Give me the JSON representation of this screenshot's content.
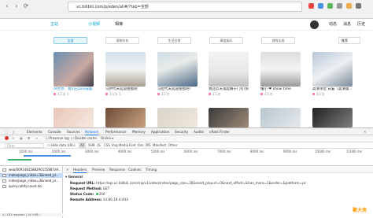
{
  "browser": {
    "url": "vc.bilibili.com/p/eden/all#/?tab=全部",
    "tabs": "",
    "nav": [
      "‹",
      "›",
      "⟳"
    ]
  },
  "site_header": {
    "home": "主站",
    "mini_video": "小视频",
    "album": "相簿",
    "right_items": [
      "动态",
      "消息",
      "历史"
    ]
  },
  "categories": [
    "全部",
    "宠物文化",
    "生活日常",
    "搞笑娱乐",
    "游戏达成"
  ],
  "sort_label": "推荐",
  "cards_row1": [
    {
      "title": "AI世界、我们已Dev成都...",
      "meta": "4万次 3"
    },
    {
      "title": "乌伊代天延迎接图吧",
      "meta": "2万次 3"
    },
    {
      "title": "乌拉代天延迎接图吧！",
      "meta": "4万次"
    },
    {
      "title": "我还云天景起舞于门打(好看",
      "meta": "2万次"
    },
    {
      "title": "懂小 ❤ show time",
      "meta": "4万次"
    },
    {
      "title": "高清单位 白猫（高清版...",
      "meta": "4万次"
    }
  ],
  "devtools": {
    "tabs": [
      "Elements",
      "Console",
      "Sources",
      "Network",
      "Performance",
      "Memory",
      "Application",
      "Security",
      "Audits",
      "vRats Finder"
    ],
    "active_tab": "Network",
    "toolbar": [
      "Preserve log",
      "Disable cache",
      "Online"
    ],
    "filters": [
      "Filter",
      "Hide data URLs",
      "All",
      "XHR",
      "JS",
      "CSS",
      "Img",
      "Media",
      "Font",
      "Doc",
      "WS",
      "Manifest",
      "Other"
    ],
    "ticks": [
      "1000 ms",
      "2000 ms",
      "3000 ms",
      "4000 ms",
      "5000 ms",
      "6000 ms",
      "7000 ms",
      "8000 ms",
      "9000 ms",
      "10000 ms",
      "11000 ms"
    ],
    "requests": [
      "web/0091481588290155887a9...",
      "index/page_index=3&need_pl...",
      "index/page_index=3&need_pl...",
      "query.notify.count.do"
    ],
    "status_bar": "4 / 183 requests | 10.9 KB /",
    "detail_tabs": [
      "Headers",
      "Preview",
      "Response",
      "Cookies",
      "Timing"
    ],
    "general_label": "General",
    "headers": [
      {
        "k": "Request URL:",
        "v": "https://api.vc.bilibili.com/clip/v1/video/index/page_size=30&need_playurl=0&next_offset=&has_more=1&order=&platform=pc"
      },
      {
        "k": "Request Method:",
        "v": "GET"
      },
      {
        "k": "Status Code:",
        "v": "200"
      },
      {
        "k": "Remote Address:",
        "v": "14.80.19.4:443"
      }
    ]
  },
  "watermark": "聚大侠"
}
